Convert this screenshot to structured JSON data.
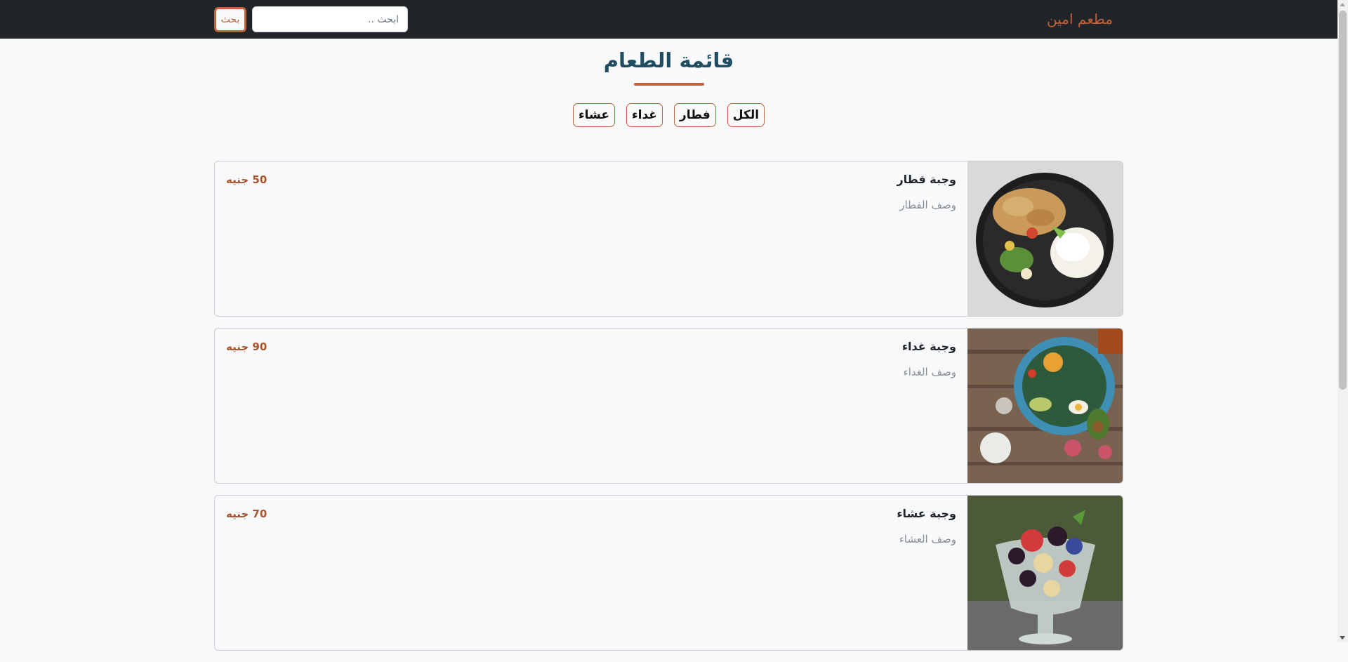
{
  "colors": {
    "navbar_bg": "#212529",
    "accent": "#c0623a",
    "title": "#1f4e63",
    "price": "#a9522b"
  },
  "navbar": {
    "brand": "مطعم امين",
    "search_placeholder": "ابحث ..",
    "search_button": "بحث"
  },
  "page_title": "قائمة الطعام",
  "filters": [
    {
      "label": "الكل"
    },
    {
      "label": "فطار"
    },
    {
      "label": "غداء"
    },
    {
      "label": "عشاء"
    }
  ],
  "items": [
    {
      "name": "وجبة فطار",
      "description": "وصف الفطار",
      "price": "50 جنيه",
      "image": "plate-with-rice-and-chicken"
    },
    {
      "name": "وجبة غداء",
      "description": "وصف الغداء",
      "price": "90 جنيه",
      "image": "salad-bowl-on-wooden-table"
    },
    {
      "name": "وجبة عشاء",
      "description": "وصف العشاء",
      "price": "70 جنيه",
      "image": "fruit-cup-dessert"
    }
  ]
}
